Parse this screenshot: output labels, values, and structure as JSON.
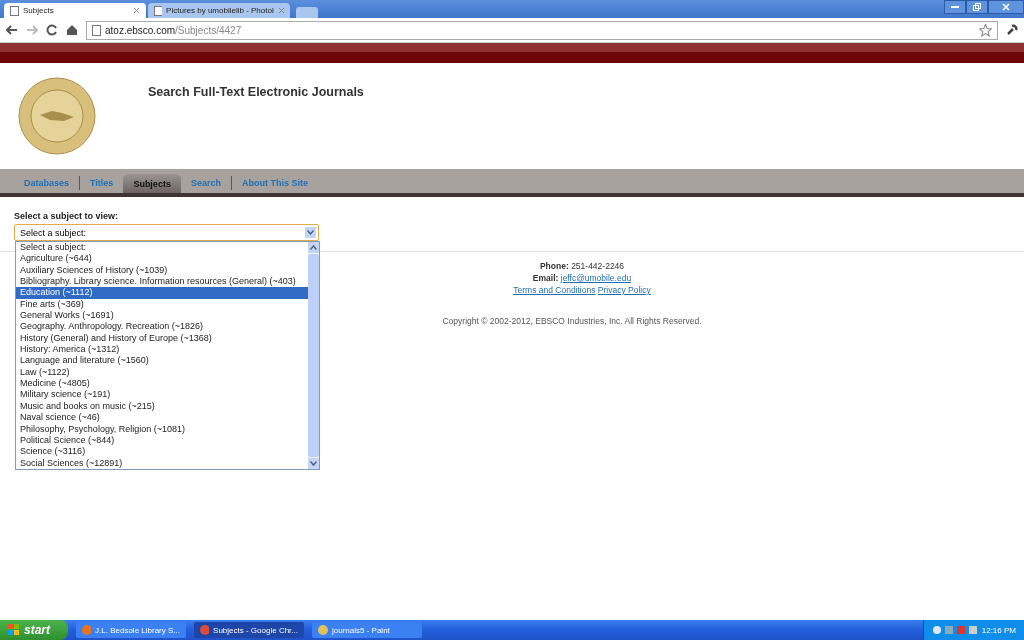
{
  "browser": {
    "tabs": [
      {
        "title": "Subjects",
        "selected": true
      },
      {
        "title": "Pictures by umobilelib - Photol",
        "selected": false
      }
    ],
    "url_host": "atoz.ebsco.com",
    "url_path": "/Subjects/4427"
  },
  "site": {
    "title": "Search Full-Text Electronic Journals",
    "nav": [
      {
        "label": "Databases",
        "selected": false
      },
      {
        "label": "Titles",
        "selected": false
      },
      {
        "label": "Subjects",
        "selected": true
      },
      {
        "label": "Search",
        "selected": false
      },
      {
        "label": "About This Site",
        "selected": false
      }
    ],
    "subject_label": "Select a subject to view:",
    "select_value": "Select a subject:",
    "options": [
      {
        "label": "Select a subject:",
        "selected": false
      },
      {
        "label": "Agriculture (~644)",
        "selected": false
      },
      {
        "label": "Auxiliary Sciences of History (~1039)",
        "selected": false
      },
      {
        "label": "Bibliography. Library science. Information resources (General) (~403)",
        "selected": false
      },
      {
        "label": "Education (~1112)",
        "selected": true
      },
      {
        "label": "Fine arts (~369)",
        "selected": false
      },
      {
        "label": "General Works (~1691)",
        "selected": false
      },
      {
        "label": "Geography. Anthropology. Recreation (~1826)",
        "selected": false
      },
      {
        "label": "History (General) and History of Europe (~1368)",
        "selected": false
      },
      {
        "label": "History: America (~1312)",
        "selected": false
      },
      {
        "label": "Language and literature (~1560)",
        "selected": false
      },
      {
        "label": "Law (~1122)",
        "selected": false
      },
      {
        "label": "Medicine (~4805)",
        "selected": false
      },
      {
        "label": "Military science (~191)",
        "selected": false
      },
      {
        "label": "Music and books on music (~215)",
        "selected": false
      },
      {
        "label": "Naval science (~46)",
        "selected": false
      },
      {
        "label": "Philosophy, Psychology, Religion (~1081)",
        "selected": false
      },
      {
        "label": "Political Science (~844)",
        "selected": false
      },
      {
        "label": "Science (~3116)",
        "selected": false
      },
      {
        "label": "Social Sciences (~12891)",
        "selected": false
      }
    ],
    "footer": {
      "phone_label": "Phone:",
      "phone": "251-442-2246",
      "email_label": "Email:",
      "email": "jeffc@umobile.edu",
      "links": [
        "Terms and Conditions",
        "Privacy Policy"
      ],
      "copyright": "Copyright © 2002-2012, EBSCO Industries, Inc. All Rights Reserved."
    }
  },
  "taskbar": {
    "start": "start",
    "tasks": [
      {
        "title": "J.L. Bedsole Library S...",
        "selected": false
      },
      {
        "title": "Subjects - Google Chr...",
        "selected": true
      },
      {
        "title": "journals5 - Paint",
        "selected": false
      }
    ],
    "clock": "12:16 PM"
  }
}
